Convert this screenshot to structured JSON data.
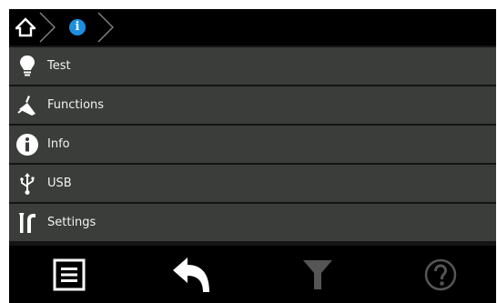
{
  "breadcrumb": {
    "home_icon": "home-icon",
    "current_icon": "info-icon",
    "current_glyph": "i"
  },
  "menu": {
    "items": [
      {
        "label": "Test",
        "icon": "lightbulb-icon"
      },
      {
        "label": "Functions",
        "icon": "probe-icon"
      },
      {
        "label": "Info",
        "icon": "info-icon",
        "glyph": "i"
      },
      {
        "label": "USB",
        "icon": "usb-icon"
      },
      {
        "label": "Settings",
        "icon": "tools-icon"
      }
    ]
  },
  "toolbar": {
    "buttons": [
      {
        "icon": "list-icon",
        "enabled": true
      },
      {
        "icon": "back-arrow-icon",
        "enabled": true
      },
      {
        "icon": "filter-icon",
        "enabled": false
      },
      {
        "icon": "help-icon",
        "enabled": false,
        "glyph": "?"
      }
    ]
  },
  "colors": {
    "accent": "#1e8fe0",
    "menu_bg": "#3a3d3a",
    "bar_bg": "#000000",
    "disabled": "#555555"
  }
}
